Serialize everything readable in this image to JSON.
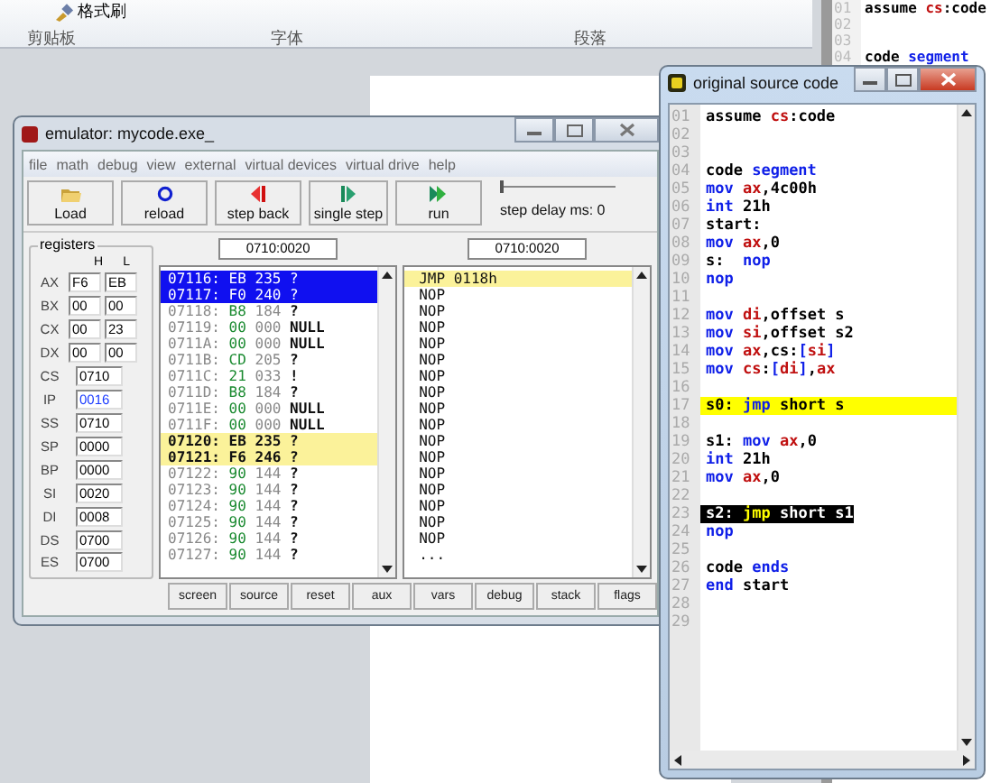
{
  "word_ribbon": {
    "format_painter": "格式刷",
    "groups": [
      "剪贴板",
      "字体",
      "段落"
    ]
  },
  "background_editor": {
    "lines": [
      {
        "number": "01",
        "segments": [
          {
            "text": "assume ",
            "kind": "plain"
          },
          {
            "text": "cs",
            "kind": "register"
          },
          {
            "text": ":code",
            "kind": "plain"
          }
        ]
      },
      {
        "number": "02"
      },
      {
        "number": "03"
      },
      {
        "number": "04",
        "segments": [
          {
            "text": "code ",
            "kind": "plain"
          },
          {
            "text": "segment",
            "kind": "keyword"
          }
        ]
      }
    ]
  },
  "emulator": {
    "title": "emulator: mycode.exe_",
    "menu": [
      "file",
      "math",
      "debug",
      "view",
      "external",
      "virtual devices",
      "virtual drive",
      "help"
    ],
    "toolbar": [
      {
        "label": "Load"
      },
      {
        "label": "reload"
      },
      {
        "label": "step back"
      },
      {
        "label": "single step"
      },
      {
        "label": "run"
      }
    ],
    "step_delay": {
      "label": "step delay ms: 0",
      "level": 0
    },
    "registers": {
      "title": "registers",
      "columns": [
        "H",
        "L"
      ],
      "pairs": [
        {
          "name": "AX",
          "h": "F6",
          "l": "EB"
        },
        {
          "name": "BX",
          "h": "00",
          "l": "00"
        },
        {
          "name": "CX",
          "h": "00",
          "l": "23"
        },
        {
          "name": "DX",
          "h": "00",
          "l": "00"
        }
      ],
      "words": [
        {
          "name": "CS",
          "value": "0710",
          "changed": false
        },
        {
          "name": "IP",
          "value": "0016",
          "changed": true
        },
        {
          "name": "SS",
          "value": "0710",
          "changed": false
        },
        {
          "name": "SP",
          "value": "0000",
          "changed": false
        },
        {
          "name": "BP",
          "value": "0000",
          "changed": false
        },
        {
          "name": "SI",
          "value": "0020",
          "changed": false
        },
        {
          "name": "DI",
          "value": "0008",
          "changed": false
        },
        {
          "name": "DS",
          "value": "0700",
          "changed": false
        },
        {
          "name": "ES",
          "value": "0700",
          "changed": false
        }
      ]
    },
    "memory": {
      "address": "0710:0020",
      "rows": [
        {
          "address": "07116:",
          "hex": "EB",
          "dec": "235",
          "char": "?",
          "selected": true,
          "current": false
        },
        {
          "address": "07117:",
          "hex": "F0",
          "dec": "240",
          "char": "?",
          "selected": true,
          "current": false
        },
        {
          "address": "07118:",
          "hex": "B8",
          "dec": "184",
          "char": "?",
          "selected": false,
          "current": false
        },
        {
          "address": "07119:",
          "hex": "00",
          "dec": "000",
          "char": "NULL",
          "selected": false,
          "current": false
        },
        {
          "address": "0711A:",
          "hex": "00",
          "dec": "000",
          "char": "NULL",
          "selected": false,
          "current": false
        },
        {
          "address": "0711B:",
          "hex": "CD",
          "dec": "205",
          "char": "?",
          "selected": false,
          "current": false
        },
        {
          "address": "0711C:",
          "hex": "21",
          "dec": "033",
          "char": "!",
          "selected": false,
          "current": false
        },
        {
          "address": "0711D:",
          "hex": "B8",
          "dec": "184",
          "char": "?",
          "selected": false,
          "current": false
        },
        {
          "address": "0711E:",
          "hex": "00",
          "dec": "000",
          "char": "NULL",
          "selected": false,
          "current": false
        },
        {
          "address": "0711F:",
          "hex": "00",
          "dec": "000",
          "char": "NULL",
          "selected": false,
          "current": false
        },
        {
          "address": "07120:",
          "hex": "EB",
          "dec": "235",
          "char": "?",
          "selected": false,
          "current": true
        },
        {
          "address": "07121:",
          "hex": "F6",
          "dec": "246",
          "char": "?",
          "selected": false,
          "current": true
        },
        {
          "address": "07122:",
          "hex": "90",
          "dec": "144",
          "char": "?",
          "selected": false,
          "current": false
        },
        {
          "address": "07123:",
          "hex": "90",
          "dec": "144",
          "char": "?",
          "selected": false,
          "current": false
        },
        {
          "address": "07124:",
          "hex": "90",
          "dec": "144",
          "char": "?",
          "selected": false,
          "current": false
        },
        {
          "address": "07125:",
          "hex": "90",
          "dec": "144",
          "char": "?",
          "selected": false,
          "current": false
        },
        {
          "address": "07126:",
          "hex": "90",
          "dec": "144",
          "char": "?",
          "selected": false,
          "current": false
        },
        {
          "address": "07127:",
          "hex": "90",
          "dec": "144",
          "char": "?",
          "selected": false,
          "current": false
        }
      ]
    },
    "disassembly": {
      "address": "0710:0020",
      "rows": [
        {
          "text": "JMP 0118h",
          "current": true
        },
        {
          "text": "NOP",
          "current": false
        },
        {
          "text": "NOP",
          "current": false
        },
        {
          "text": "NOP",
          "current": false
        },
        {
          "text": "NOP",
          "current": false
        },
        {
          "text": "NOP",
          "current": false
        },
        {
          "text": "NOP",
          "current": false
        },
        {
          "text": "NOP",
          "current": false
        },
        {
          "text": "NOP",
          "current": false
        },
        {
          "text": "NOP",
          "current": false
        },
        {
          "text": "NOP",
          "current": false
        },
        {
          "text": "NOP",
          "current": false
        },
        {
          "text": "NOP",
          "current": false
        },
        {
          "text": "NOP",
          "current": false
        },
        {
          "text": "NOP",
          "current": false
        },
        {
          "text": "NOP",
          "current": false
        },
        {
          "text": "NOP",
          "current": false
        },
        {
          "text": "...",
          "current": false
        }
      ]
    },
    "buttons": [
      "screen",
      "source",
      "reset",
      "aux",
      "vars",
      "debug",
      "stack",
      "flags"
    ]
  },
  "source_window": {
    "title": "original source code",
    "lines": [
      {
        "number": "01",
        "current": false,
        "selected": false,
        "segments": [
          {
            "text": "assume ",
            "kind": "plain"
          },
          {
            "text": "cs",
            "kind": "register"
          },
          {
            "text": ":code",
            "kind": "plain"
          }
        ]
      },
      {
        "number": "02",
        "current": false,
        "selected": false
      },
      {
        "number": "03",
        "current": false,
        "selected": false
      },
      {
        "number": "04",
        "current": false,
        "selected": false,
        "segments": [
          {
            "text": "code ",
            "kind": "plain"
          },
          {
            "text": "segment",
            "kind": "keyword"
          }
        ]
      },
      {
        "number": "05",
        "current": false,
        "selected": false,
        "segments": [
          {
            "text": "mov ",
            "kind": "keyword"
          },
          {
            "text": "ax",
            "kind": "register"
          },
          {
            "text": ",4c00h",
            "kind": "plain"
          }
        ]
      },
      {
        "number": "06",
        "current": false,
        "selected": false,
        "segments": [
          {
            "text": "int",
            "kind": "keyword"
          },
          {
            "text": " 21h",
            "kind": "plain"
          }
        ]
      },
      {
        "number": "07",
        "current": false,
        "selected": false,
        "segments": [
          {
            "text": "start:",
            "kind": "plain"
          }
        ]
      },
      {
        "number": "08",
        "current": false,
        "selected": false,
        "segments": [
          {
            "text": "mov ",
            "kind": "keyword"
          },
          {
            "text": "ax",
            "kind": "register"
          },
          {
            "text": ",0",
            "kind": "plain"
          }
        ]
      },
      {
        "number": "09",
        "current": false,
        "selected": false,
        "segments": [
          {
            "text": "s:  ",
            "kind": "plain"
          },
          {
            "text": "nop",
            "kind": "keyword"
          }
        ]
      },
      {
        "number": "10",
        "current": false,
        "selected": false,
        "segments": [
          {
            "text": "nop",
            "kind": "keyword"
          }
        ]
      },
      {
        "number": "11",
        "current": false,
        "selected": false
      },
      {
        "number": "12",
        "current": false,
        "selected": false,
        "segments": [
          {
            "text": "mov ",
            "kind": "keyword"
          },
          {
            "text": "di",
            "kind": "register"
          },
          {
            "text": ",offset s",
            "kind": "plain"
          }
        ]
      },
      {
        "number": "13",
        "current": false,
        "selected": false,
        "segments": [
          {
            "text": "mov ",
            "kind": "keyword"
          },
          {
            "text": "si",
            "kind": "register"
          },
          {
            "text": ",offset s2",
            "kind": "plain"
          }
        ]
      },
      {
        "number": "14",
        "current": false,
        "selected": false,
        "segments": [
          {
            "text": "mov ",
            "kind": "keyword"
          },
          {
            "text": "ax",
            "kind": "register"
          },
          {
            "text": ",cs:",
            "kind": "plain"
          },
          {
            "text": "[",
            "kind": "keyword"
          },
          {
            "text": "si",
            "kind": "register"
          },
          {
            "text": "]",
            "kind": "keyword"
          }
        ]
      },
      {
        "number": "15",
        "current": false,
        "selected": false,
        "segments": [
          {
            "text": "mov ",
            "kind": "keyword"
          },
          {
            "text": "cs",
            "kind": "register"
          },
          {
            "text": ":",
            "kind": "plain"
          },
          {
            "text": "[",
            "kind": "keyword"
          },
          {
            "text": "di",
            "kind": "register"
          },
          {
            "text": "]",
            "kind": "keyword"
          },
          {
            "text": ",",
            "kind": "plain"
          },
          {
            "text": "ax",
            "kind": "register"
          }
        ]
      },
      {
        "number": "16",
        "current": false,
        "selected": false
      },
      {
        "number": "17",
        "current": true,
        "selected": false,
        "segments": [
          {
            "text": "s0: ",
            "kind": "plain"
          },
          {
            "text": "jmp",
            "kind": "keyword"
          },
          {
            "text": " short s",
            "kind": "plain"
          }
        ]
      },
      {
        "number": "18",
        "current": false,
        "selected": false
      },
      {
        "number": "19",
        "current": false,
        "selected": false,
        "segments": [
          {
            "text": "s1: ",
            "kind": "plain"
          },
          {
            "text": "mov ",
            "kind": "keyword"
          },
          {
            "text": "ax",
            "kind": "register"
          },
          {
            "text": ",0",
            "kind": "plain"
          }
        ]
      },
      {
        "number": "20",
        "current": false,
        "selected": false,
        "segments": [
          {
            "text": "int",
            "kind": "keyword"
          },
          {
            "text": " 21h",
            "kind": "plain"
          }
        ]
      },
      {
        "number": "21",
        "current": false,
        "selected": false,
        "segments": [
          {
            "text": "mov ",
            "kind": "keyword"
          },
          {
            "text": "ax",
            "kind": "register"
          },
          {
            "text": ",0",
            "kind": "plain"
          }
        ]
      },
      {
        "number": "22",
        "current": false,
        "selected": false
      },
      {
        "number": "23",
        "current": false,
        "selected": true,
        "segments": [
          {
            "text": "s2: ",
            "kind": "plain"
          },
          {
            "text": "jmp",
            "kind": "keyword"
          },
          {
            "text": " short s1",
            "kind": "plain"
          }
        ]
      },
      {
        "number": "24",
        "current": false,
        "selected": false,
        "segments": [
          {
            "text": "nop",
            "kind": "keyword"
          }
        ]
      },
      {
        "number": "25",
        "current": false,
        "selected": false
      },
      {
        "number": "26",
        "current": false,
        "selected": false,
        "segments": [
          {
            "text": "code ",
            "kind": "plain"
          },
          {
            "text": "ends",
            "kind": "keyword"
          }
        ]
      },
      {
        "number": "27",
        "current": false,
        "selected": false,
        "segments": [
          {
            "text": "end",
            "kind": "keyword"
          },
          {
            "text": " start",
            "kind": "plain"
          }
        ]
      },
      {
        "number": "28",
        "current": false,
        "selected": false
      },
      {
        "number": "29",
        "current": false,
        "selected": false
      }
    ]
  }
}
